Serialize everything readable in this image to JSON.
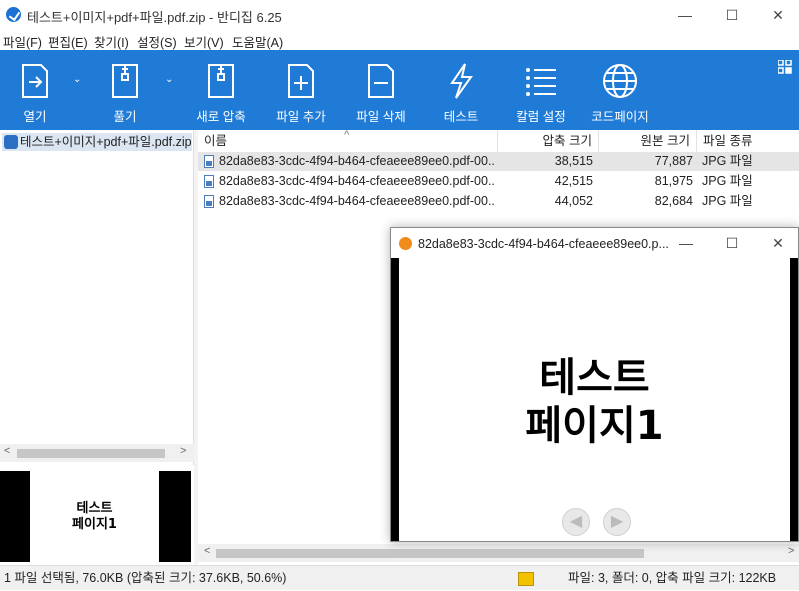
{
  "window": {
    "title": "테스트+이미지+pdf+파일.pdf.zip - 반디집 6.25",
    "minimize": "—",
    "maximize": "☐",
    "close": "✕"
  },
  "menu": [
    {
      "label": "파일(F)"
    },
    {
      "label": "편집(E)"
    },
    {
      "label": "찾기(I)"
    },
    {
      "label": "설정(S)"
    },
    {
      "label": "보기(V)"
    },
    {
      "label": "도움말(A)"
    }
  ],
  "toolbar": {
    "open": "열기",
    "extract": "풀기",
    "new_archive": "새로 압축",
    "add_file": "파일 추가",
    "delete_file": "파일 삭제",
    "test": "테스트",
    "column_settings": "칼럼 설정",
    "codepage": "코드페이지",
    "dropdown": "⌄"
  },
  "tree": {
    "item": "테스트+이미지+pdf+파일.pdf.zip"
  },
  "columns": {
    "name": "이름",
    "compressed": "압축 크기",
    "original": "원본 크기",
    "type": "파일 종류",
    "sort_indicator": "^"
  },
  "files": [
    {
      "name": "82da8e83-3cdc-4f94-b464-cfeaeee89ee0.pdf-00...",
      "compressed": "38,515",
      "original": "77,887",
      "type": "JPG 파일",
      "selected": true
    },
    {
      "name": "82da8e83-3cdc-4f94-b464-cfeaeee89ee0.pdf-00...",
      "compressed": "42,515",
      "original": "81,975",
      "type": "JPG 파일",
      "selected": false
    },
    {
      "name": "82da8e83-3cdc-4f94-b464-cfeaeee89ee0.pdf-00...",
      "compressed": "44,052",
      "original": "82,684",
      "type": "JPG 파일",
      "selected": false
    }
  ],
  "preview": {
    "line1": "테스트",
    "line2": "페이지1"
  },
  "viewer": {
    "title": "82da8e83-3cdc-4f94-b464-cfeaeee89ee0.p...",
    "minimize": "—",
    "maximize": "☐",
    "close": "✕",
    "line1": "테스트",
    "line2": "페이지1",
    "prev": "◀",
    "next": "▶"
  },
  "scroll": {
    "left": "<",
    "right": ">"
  },
  "status": {
    "left": "1 파일 선택됨, 76.0KB (압축된 크기: 37.6KB, 50.6%)",
    "right": "파일: 3, 폴더: 0, 압축 파일 크기: 122KB"
  },
  "colors": {
    "toolbar": "#1f7bd6",
    "selection": "#e5e5e5",
    "tree_selection": "#dbe6f2"
  }
}
